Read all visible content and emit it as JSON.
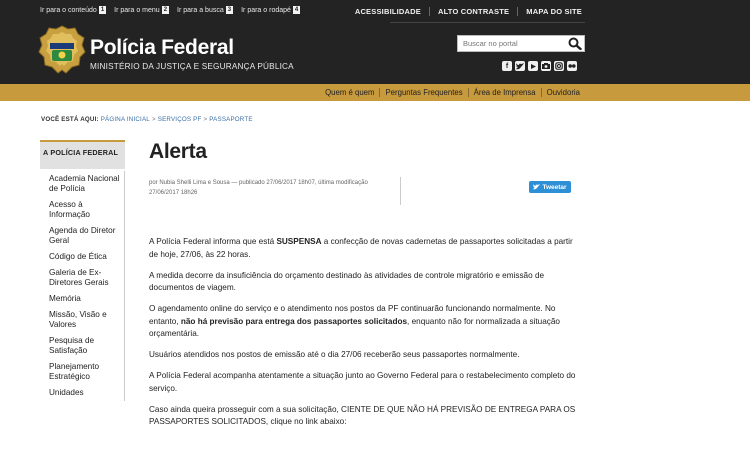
{
  "accessibility": {
    "links": [
      {
        "label": "Ir para o conteúdo",
        "key": "1"
      },
      {
        "label": "Ir para o menu",
        "key": "2"
      },
      {
        "label": "Ir para a busca",
        "key": "3"
      },
      {
        "label": "Ir para o rodapé",
        "key": "4"
      }
    ],
    "top_links": [
      "ACESSIBILIDADE",
      "ALTO CONTRASTE",
      "MAPA DO SITE"
    ]
  },
  "header": {
    "title": "Polícia Federal",
    "subtitle": "MINISTÉRIO DA JUSTIÇA E SEGURANÇA PÚBLICA",
    "logo_text": "POLÍCIA FEDERAL",
    "search_placeholder": "Buscar no portal"
  },
  "social_icons": [
    "facebook-icon",
    "twitter-icon",
    "youtube-icon",
    "flickr-icon",
    "instagram-icon",
    "photo-icon"
  ],
  "service_bar": [
    "Quem é quem",
    "Perguntas Frequentes",
    "Área de Imprensa",
    "Ouvidoria"
  ],
  "breadcrumb": {
    "label": "VOCÊ ESTÁ AQUI:",
    "items": [
      "PÁGINA INICIAL",
      "SERVIÇOS PF",
      "PASSAPORTE"
    ]
  },
  "sidebar": {
    "heading": "A POLÍCIA FEDERAL",
    "items": [
      "Academia Nacional de Polícia",
      "Acesso à Informação",
      "Agenda do Diretor Geral",
      "Código de Ética",
      "Galeria de Ex-Diretores Gerais",
      "Memória",
      "Missão, Visão e Valores",
      "Pesquisa de Satisfação",
      "Planejamento Estratégico",
      "Unidades"
    ]
  },
  "article": {
    "title": "Alerta",
    "byline": "por Nubia Shelli Lima e Sousa — publicado 27/06/2017 18h07, última modificação 27/06/2017 18h26",
    "tweet_label": "Tweetar",
    "p1_a": "A Polícia Federal informa que está ",
    "p1_b": "SUSPENSA",
    "p1_c": " a confecção de novas cadernetas de passaportes solicitadas a partir de hoje, 27/06, às 22 horas.",
    "p2": "A medida decorre da insuficiência do orçamento destinado às atividades de controle migratório e emissão de documentos de viagem.",
    "p3_a": "O agendamento online do serviço e o atendimento nos postos da PF continuarão funcionando normalmente. No entanto, ",
    "p3_b": "não há previsão para entrega dos passaportes solicitados",
    "p3_c": ", enquanto não for normalizada a situação orçamentária.",
    "p4": "Usuários atendidos nos postos de emissão até o dia 27/06 receberão seus passaportes normalmente.",
    "p5": "A Polícia Federal acompanha atentamente a situação junto ao Governo Federal para o restabelecimento completo do serviço.",
    "p6": "Caso ainda queira prosseguir com a sua solicitação, CIENTE DE QUE NÃO HÁ PREVISÃO DE ENTREGA PARA OS PASSAPORTES SOLICITADOS, clique no link abaixo:"
  },
  "colors": {
    "header_bg": "#232323",
    "service_bar": "#c79a3e",
    "link": "#3a6ea5",
    "tweet": "#2d8fd5"
  }
}
